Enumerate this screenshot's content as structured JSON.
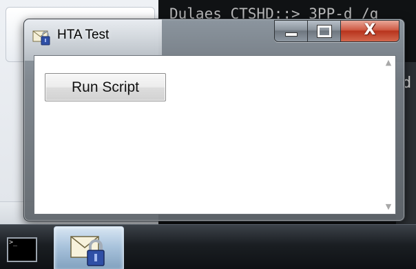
{
  "window": {
    "title": "HTA Test",
    "icon": "mail-lock-icon",
    "minimize_icon": "minimize-icon",
    "maximize_icon": "maximize-icon",
    "close_icon": "close-icon",
    "close_glyph": "X"
  },
  "content": {
    "run_button_label": "Run Script"
  },
  "scrollbar": {
    "up_glyph": "▲",
    "down_glyph": "▼"
  },
  "background": {
    "terminal_text": "Dulaes  CTSHD::> 3PP-d  /g",
    "right_letter": "d"
  },
  "taskbar": {
    "items": [
      {
        "icon": "command-prompt-icon",
        "prompt": ">_"
      },
      {
        "icon": "mail-lock-icon",
        "active": true
      }
    ]
  },
  "colors": {
    "close_button": "#c9442e",
    "taskbar": "#1a1e22",
    "padlock": "#2f4fa6"
  }
}
